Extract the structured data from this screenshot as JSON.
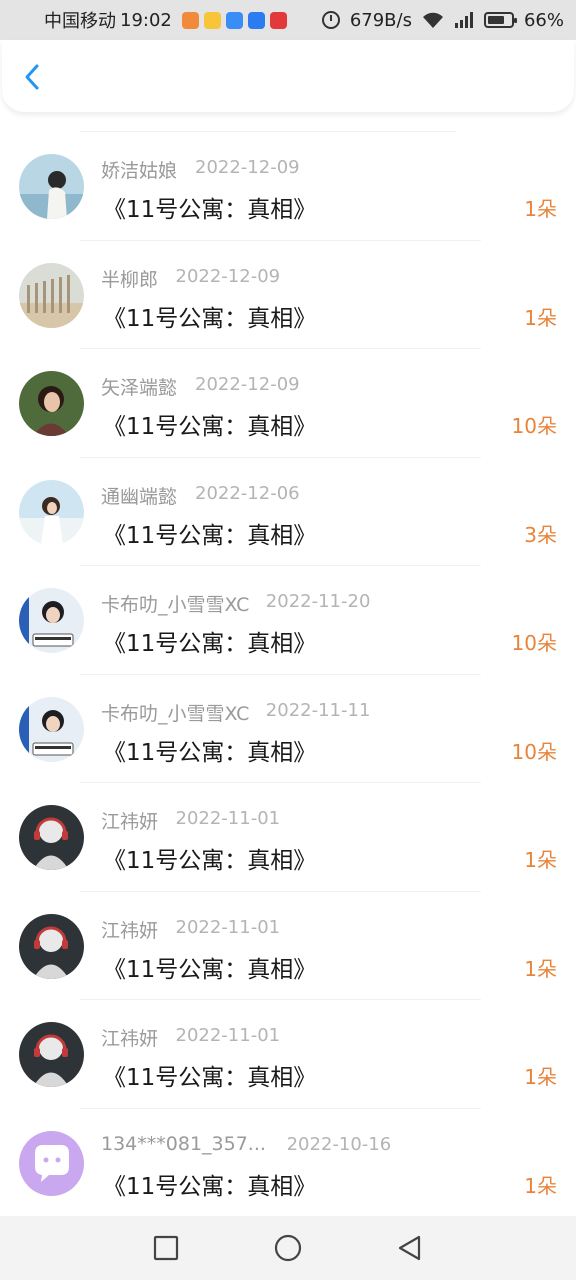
{
  "status_bar": {
    "carrier": "中国移动",
    "time": "19:02",
    "net_speed": "679B/s",
    "battery": "66%",
    "network_type": "4G"
  },
  "header": {
    "back_icon": "chevron-left-icon",
    "accent_color": "#2196f3"
  },
  "colors": {
    "amount": "#e8843a",
    "name": "#9a9a9a",
    "date": "#b4b4b4"
  },
  "items": [
    {
      "name": "娇洁姑娘",
      "date": "2022-12-09",
      "title": "《11号公寓：真相》",
      "amount": "1朵",
      "avatar": "girl-photo"
    },
    {
      "name": "半柳郎",
      "date": "2022-12-09",
      "title": "《11号公寓：真相》",
      "amount": "1朵",
      "avatar": "fence-photo"
    },
    {
      "name": "矢泽端懿",
      "date": "2022-12-09",
      "title": "《11号公寓：真相》",
      "amount": "10朵",
      "avatar": "woman-photo"
    },
    {
      "name": "通幽端懿",
      "date": "2022-12-06",
      "title": "《11号公寓：真相》",
      "amount": "3朵",
      "avatar": "beach-photo"
    },
    {
      "name": "卡布叻_小雪雪XC",
      "date": "2022-11-20",
      "title": "《11号公寓：真相》",
      "amount": "10朵",
      "avatar": "boy-photo"
    },
    {
      "name": "卡布叻_小雪雪XC",
      "date": "2022-11-11",
      "title": "《11号公寓：真相》",
      "amount": "10朵",
      "avatar": "boy-photo"
    },
    {
      "name": "江祎妍",
      "date": "2022-11-01",
      "title": "《11号公寓：真相》",
      "amount": "1朵",
      "avatar": "headphone-photo"
    },
    {
      "name": "江祎妍",
      "date": "2022-11-01",
      "title": "《11号公寓：真相》",
      "amount": "1朵",
      "avatar": "headphone-photo"
    },
    {
      "name": "江祎妍",
      "date": "2022-11-01",
      "title": "《11号公寓：真相》",
      "amount": "1朵",
      "avatar": "headphone-photo"
    },
    {
      "name": "134***081_357...",
      "date": "2022-10-16",
      "title": "《11号公寓：真相》",
      "amount": "1朵",
      "avatar": "chat-bubble-icon"
    }
  ]
}
